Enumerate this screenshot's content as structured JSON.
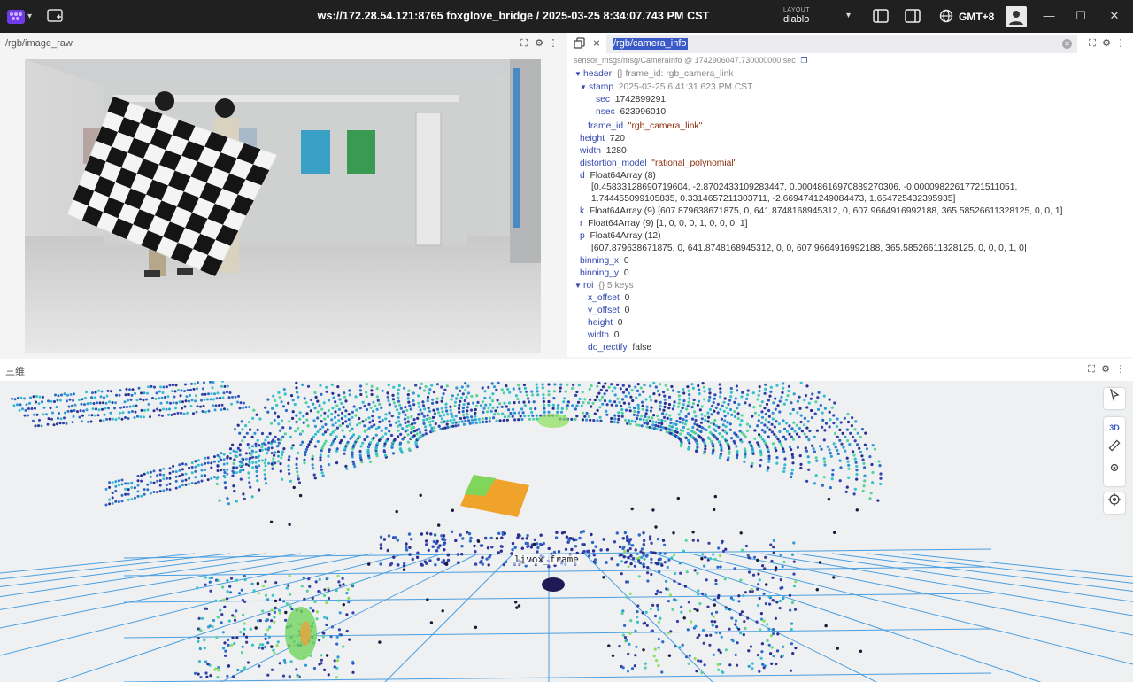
{
  "topbar": {
    "title": "ws://172.28.54.121:8765 foxglove_bridge / 2025-03-25 8:34:07.743 PM CST",
    "layout_label": "LAYOUT",
    "layout_value": "diablo",
    "timezone": "GMT+8"
  },
  "image_panel": {
    "title": "/rgb/image_raw"
  },
  "raw_panel": {
    "topic": "/rgb/camera_info",
    "message_type": "sensor_msgs/msg/CameraInfo @ 1742906047.730000000 sec",
    "rows": [
      {
        "key": "header",
        "meta": "{}  frame_id: rgb_camera_link",
        "val": "",
        "str": "",
        "arrow": "▼"
      },
      {
        "key": "stamp",
        "meta": "2025-03-25 6:41:31.623 PM CST",
        "val": "",
        "str": "",
        "arrow": "▼"
      },
      {
        "key": "sec",
        "meta": "",
        "val": "1742899291",
        "str": "",
        "arrow": ""
      },
      {
        "key": "nsec",
        "meta": "",
        "val": "623996010",
        "str": "",
        "arrow": ""
      },
      {
        "key": "frame_id",
        "meta": "",
        "val": "",
        "str": "\"rgb_camera_link\"",
        "arrow": ""
      },
      {
        "key": "height",
        "meta": "",
        "val": "720",
        "str": "",
        "arrow": ""
      },
      {
        "key": "width",
        "meta": "",
        "val": "1280",
        "str": "",
        "arrow": ""
      },
      {
        "key": "distortion_model",
        "meta": "",
        "val": "",
        "str": "\"rational_polynomial\"",
        "arrow": ""
      },
      {
        "key": "d",
        "meta": "",
        "val": "Float64Array (8)",
        "str": "",
        "arrow": ""
      },
      {
        "key": "",
        "meta": "",
        "val": "[0.45833128690719604, -2.8702433109283447, 0.00048616970889270306, -0.00009822617721511051,",
        "str": "",
        "arrow": ""
      },
      {
        "key": "",
        "meta": "",
        "val": "1.744455099105835, 0.331465721130371​1, -2.6694741249084473, 1.654725432395935]",
        "str": "",
        "arrow": ""
      },
      {
        "key": "k",
        "meta": "",
        "val": "Float64Array (9) [607.879638671875, 0, 641.8748168945312, 0, 607.9664916992188, 365.58526611328125, 0, 0, 1]",
        "str": "",
        "arrow": ""
      },
      {
        "key": "r",
        "meta": "",
        "val": "Float64Array (9) [1, 0, 0, 0, 1, 0, 0, 0, 1]",
        "str": "",
        "arrow": ""
      },
      {
        "key": "p",
        "meta": "",
        "val": "Float64Array (12)",
        "str": "",
        "arrow": ""
      },
      {
        "key": "",
        "meta": "",
        "val": "[607.879638671875, 0, 641.8748168945312, 0, 0, 607.9664916992188, 365.58526611328125, 0, 0, 0, 1, 0]",
        "str": "",
        "arrow": ""
      },
      {
        "key": "binning_x",
        "meta": "",
        "val": "0",
        "str": "",
        "arrow": ""
      },
      {
        "key": "binning_y",
        "meta": "",
        "val": "0",
        "str": "",
        "arrow": ""
      },
      {
        "key": "roi",
        "meta": "{}  5 keys",
        "val": "",
        "str": "",
        "arrow": "▼"
      },
      {
        "key": "x_offset",
        "meta": "",
        "val": "0",
        "str": "",
        "arrow": ""
      },
      {
        "key": "y_offset",
        "meta": "",
        "val": "0",
        "str": "",
        "arrow": ""
      },
      {
        "key": "height",
        "meta": "",
        "val": "0",
        "str": "",
        "arrow": ""
      },
      {
        "key": "width",
        "meta": "",
        "val": "0",
        "str": "",
        "arrow": ""
      },
      {
        "key": "do_rectify",
        "meta": "",
        "val": "false",
        "str": "",
        "arrow": ""
      }
    ]
  },
  "three_panel": {
    "title": "三维",
    "frame_label": "livox_frame",
    "mode_label": "3D"
  },
  "colors": {
    "topbar": "#202020",
    "accent": "#3a5bc7",
    "key_blue": "#3348ad",
    "string_brown": "#8b2d0d",
    "grid_blue": "#3a8fd6"
  }
}
